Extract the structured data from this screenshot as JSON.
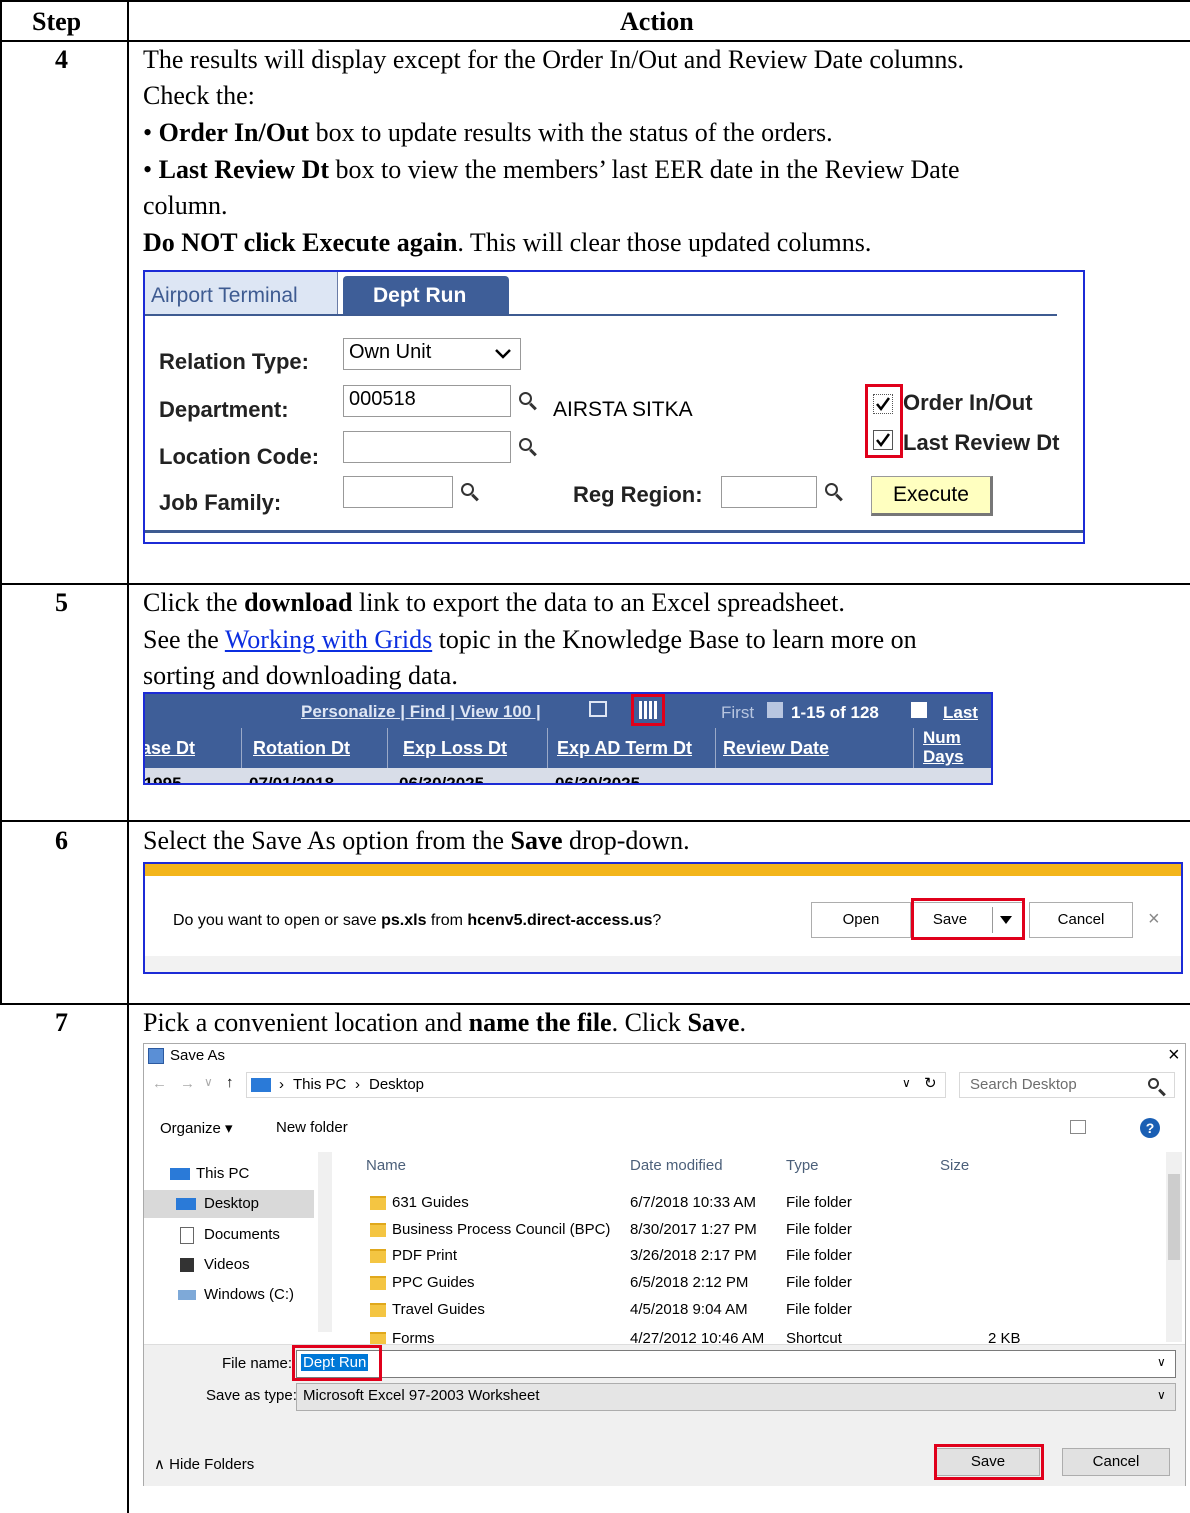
{
  "table": {
    "headers": {
      "step": "Step",
      "action": "Action"
    },
    "rows": [
      {
        "step": "4",
        "lines": {
          "l1": "The results will display except for the Order In/Out and Review Date columns.",
          "l2": "Check the:",
          "b1_bold": "Order In/Out",
          "b1_rest": " box to update results with the status of the orders.",
          "b2_bold": "Last Review Dt",
          "b2_rest": " box to view the members’ last EER date in the Review Date",
          "b2_cont": "column.",
          "warn_bold": "Do NOT click Execute again",
          "warn_rest": ". This will clear those updated columns."
        }
      },
      {
        "step": "5",
        "lines": {
          "l1_a": "Click the ",
          "l1_bold": "download",
          "l1_b": " link to export the data to an Excel spreadsheet.",
          "l2_a": "See the ",
          "l2_link": "Working with Grids",
          "l2_b": " topic in the Knowledge Base to learn more on",
          "l3": "sorting and downloading data."
        }
      },
      {
        "step": "6",
        "lines": {
          "l1_a": "Select the Save As option from the ",
          "l1_bold": "Save",
          "l1_b": " drop-down."
        }
      },
      {
        "step": "7",
        "lines": {
          "l1_a": "Pick a convenient location and ",
          "l1_bold": "name the file",
          "l1_b": ". Click ",
          "l1_bold2": "Save",
          "l1_c": "."
        }
      }
    ]
  },
  "ps_form": {
    "tabs": [
      "Airport Terminal",
      "Dept Run"
    ],
    "relation_type_label": "Relation Type:",
    "relation_type_value": "Own Unit",
    "department_label": "Department:",
    "department_value": "000518",
    "department_desc": "AIRSTA SITKA",
    "location_label": "Location Code:",
    "job_family_label": "Job Family:",
    "reg_region_label": "Reg Region:",
    "execute_label": "Execute",
    "order_inout_label": "Order In/Out",
    "last_review_label": "Last Review Dt"
  },
  "grid": {
    "links": "Personalize | Find | View 100 |",
    "first": "First",
    "range": "1-15 of 128",
    "last": "Last",
    "columns": [
      "ase Dt",
      "Rotation Dt",
      "Exp Loss Dt",
      "Exp AD Term Dt",
      "Review Date",
      "Num",
      "Days"
    ],
    "row": [
      "/1995",
      "07/01/2018",
      "06/30/2025",
      "06/30/2025"
    ]
  },
  "download_bar": {
    "prompt_a": "Do you want to open or save ",
    "file": "ps.xls",
    "prompt_b": " from ",
    "host": "hcenv5.direct-access.us",
    "prompt_c": "?",
    "open": "Open",
    "save": "Save",
    "cancel": "Cancel",
    "close": "×"
  },
  "save_dialog": {
    "title": "Save As",
    "path": [
      "This PC",
      "Desktop"
    ],
    "search_placeholder": "Search Desktop",
    "organize": "Organize ▾",
    "new_folder": "New folder",
    "tree": [
      "This PC",
      "Desktop",
      "Documents",
      "Videos",
      "Windows (C:)"
    ],
    "columns": [
      "Name",
      "Date modified",
      "Type",
      "Size"
    ],
    "files": [
      {
        "name": "631 Guides",
        "date": "6/7/2018 10:33 AM",
        "type": "File folder",
        "size": ""
      },
      {
        "name": "Business Process Council (BPC)",
        "date": "8/30/2017 1:27 PM",
        "type": "File folder",
        "size": ""
      },
      {
        "name": "PDF Print",
        "date": "3/26/2018 2:17 PM",
        "type": "File folder",
        "size": ""
      },
      {
        "name": "PPC Guides",
        "date": "6/5/2018 2:12 PM",
        "type": "File folder",
        "size": ""
      },
      {
        "name": "Travel Guides",
        "date": "4/5/2018 9:04 AM",
        "type": "File folder",
        "size": ""
      },
      {
        "name": "Forms",
        "date": "4/27/2012 10:46 AM",
        "type": "Shortcut",
        "size": "2 KB"
      }
    ],
    "file_name_label": "File name:",
    "file_name_value": "Dept Run",
    "save_type_label": "Save as type:",
    "save_type_value": "Microsoft Excel 97-2003 Worksheet",
    "hide_folders": "Hide Folders",
    "save": "Save",
    "cancel": "Cancel"
  }
}
